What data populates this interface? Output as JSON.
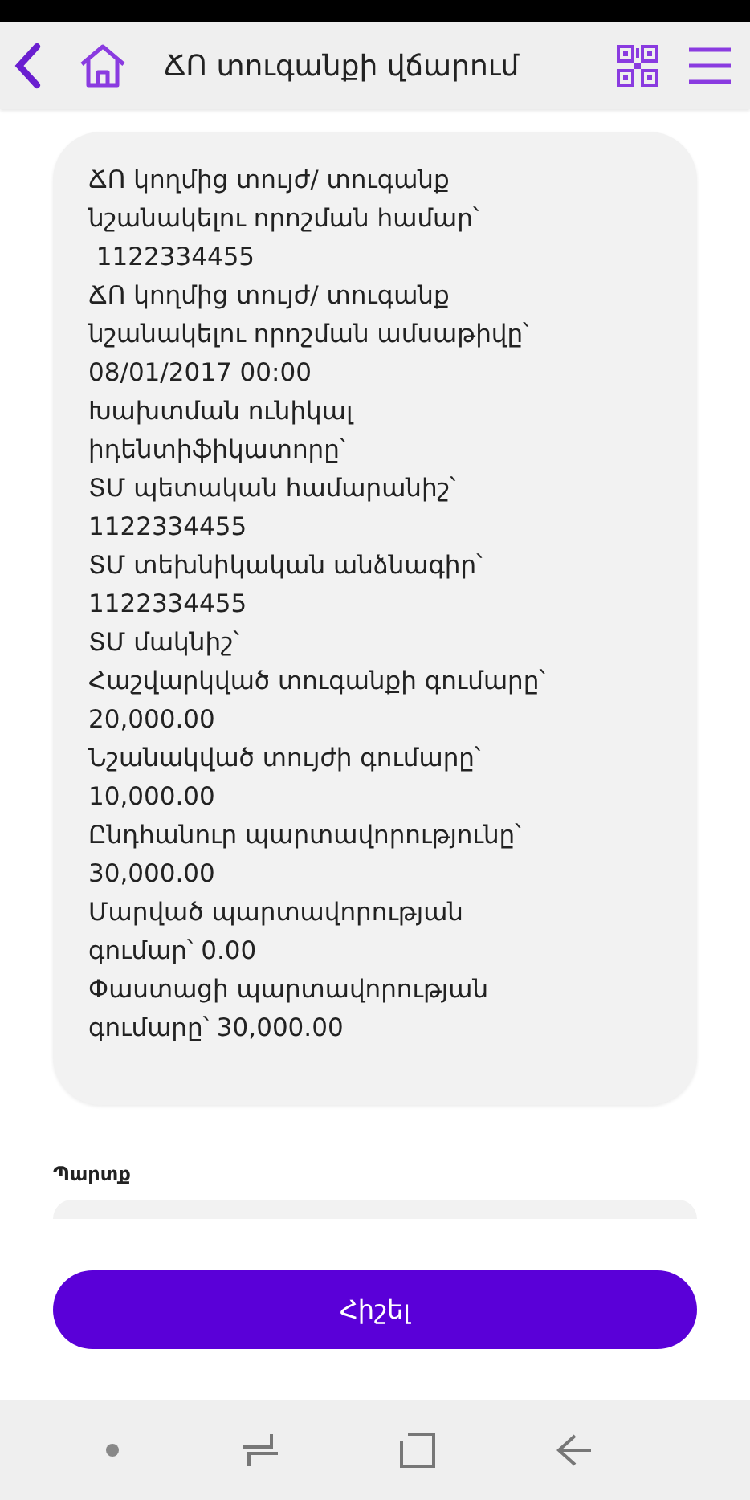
{
  "header": {
    "title": "ՃՈ տուգանքի վճարում"
  },
  "details": {
    "lines": [
      "ՃՈ կողմից տույժ/ տուգանք",
      "նշանակելու որոշման համար՝",
      " 1122334455",
      "ՃՈ կողմից տույժ/ տուգանք",
      "նշանակելու որոշման ամսաթիվը՝",
      "08/01/2017 00:00",
      "Խախտման ունիկալ",
      "իդենտիֆիկատորը՝",
      "ՏՄ պետական համարանիշ՝",
      "1122334455",
      "ՏՄ տեխնիկական անձնագիր՝",
      "1122334455",
      "ՏՄ մակնիշ՝",
      "Հաշվարկված տուգանքի գումարը՝",
      "20,000.00",
      "Նշանակված տույժի գումարը՝",
      "10,000.00",
      "Ընդհանուր պարտավորությունը՝",
      "30,000.00",
      "Մարված պարտավորության",
      "գումար՝ 0.00",
      "Փաստացի պարտավորության",
      "գումարը՝ 30,000.00"
    ]
  },
  "debt": {
    "label": "Պարտք"
  },
  "submit": {
    "label": "Հիշել"
  }
}
